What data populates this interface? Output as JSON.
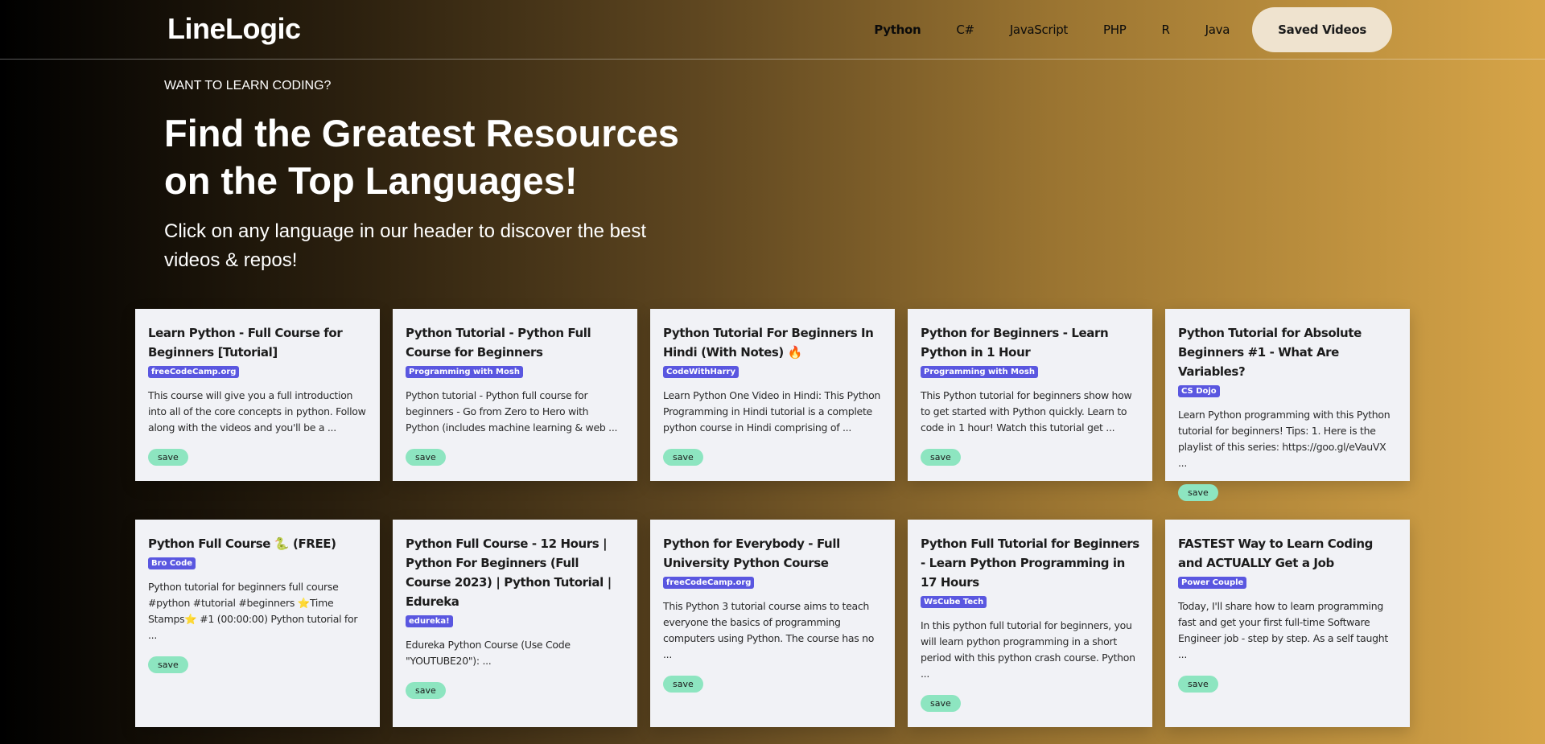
{
  "header": {
    "logo": "LineLogic",
    "nav": [
      {
        "label": "Python",
        "active": true
      },
      {
        "label": "C#"
      },
      {
        "label": "JavaScript"
      },
      {
        "label": "PHP"
      },
      {
        "label": "R"
      },
      {
        "label": "Java"
      }
    ],
    "saved_label": "Saved Videos"
  },
  "hero": {
    "eyebrow": "WANT TO LEARN CODING?",
    "title": "Find the Greatest Resources on the Top Languages!",
    "subtitle": "Click on any language in our header to discover the best videos & repos!"
  },
  "cards": [
    {
      "title": "Learn Python - Full Course for Beginners [Tutorial]",
      "channel": "freeCodeCamp.org",
      "desc": "This course will give you a full introduction into all of the core concepts in python. Follow along with the videos and you'll be a ...",
      "save": "save"
    },
    {
      "title": "Python Tutorial - Python Full Course for Beginners",
      "channel": "Programming with Mosh",
      "desc": "Python tutorial - Python full course for beginners - Go from Zero to Hero with Python (includes machine learning & web ...",
      "save": "save"
    },
    {
      "title": "Python Tutorial For Beginners In Hindi (With Notes) 🔥",
      "channel": "CodeWithHarry",
      "desc": "Learn Python One Video in Hindi: This Python Programming in Hindi tutorial is a complete python course in Hindi comprising of ...",
      "save": "save"
    },
    {
      "title": "Python for Beginners - Learn Python in 1 Hour",
      "channel": "Programming with Mosh",
      "desc": "This Python tutorial for beginners show how to get started with Python quickly. Learn to code in 1 hour! Watch this tutorial get ...",
      "save": "save"
    },
    {
      "title": "Python Tutorial for Absolute Beginners #1 - What Are Variables?",
      "channel": "CS Dojo",
      "desc": "Learn Python programming with this Python tutorial for beginners! Tips: 1. Here is the playlist of this series: https://goo.gl/eVauVX ...",
      "save": "save"
    },
    {
      "title": "Python Full Course 🐍 (FREE)",
      "channel": "Bro Code",
      "desc": "Python tutorial for beginners full course #python #tutorial #beginners ⭐️Time Stamps⭐️ #1 (00:00:00) Python tutorial for ...",
      "save": "save"
    },
    {
      "title": "Python Full Course - 12 Hours | Python For Beginners (Full Course 2023) | Python Tutorial | Edureka",
      "channel": "edureka!",
      "desc": "Edureka Python Course (Use Code \"YOUTUBE20\"): ...",
      "save": "save"
    },
    {
      "title": "Python for Everybody - Full University Python Course",
      "channel": "freeCodeCamp.org",
      "desc": "This Python 3 tutorial course aims to teach everyone the basics of programming computers using Python. The course has no ...",
      "save": "save"
    },
    {
      "title": "Python Full Tutorial for Beginners - Learn Python Programming in 17 Hours",
      "channel": "WsCube Tech",
      "desc": "In this python full tutorial for beginners, you will learn python programming in a short period with this python crash course. Python ...",
      "save": "save"
    },
    {
      "title": "FASTEST Way to Learn Coding and ACTUALLY Get a Job",
      "channel": "Power Couple",
      "desc": "Today, I'll share how to learn programming fast and get your first full-time Software Engineer job - step by step. As a self taught ...",
      "save": "save"
    }
  ]
}
